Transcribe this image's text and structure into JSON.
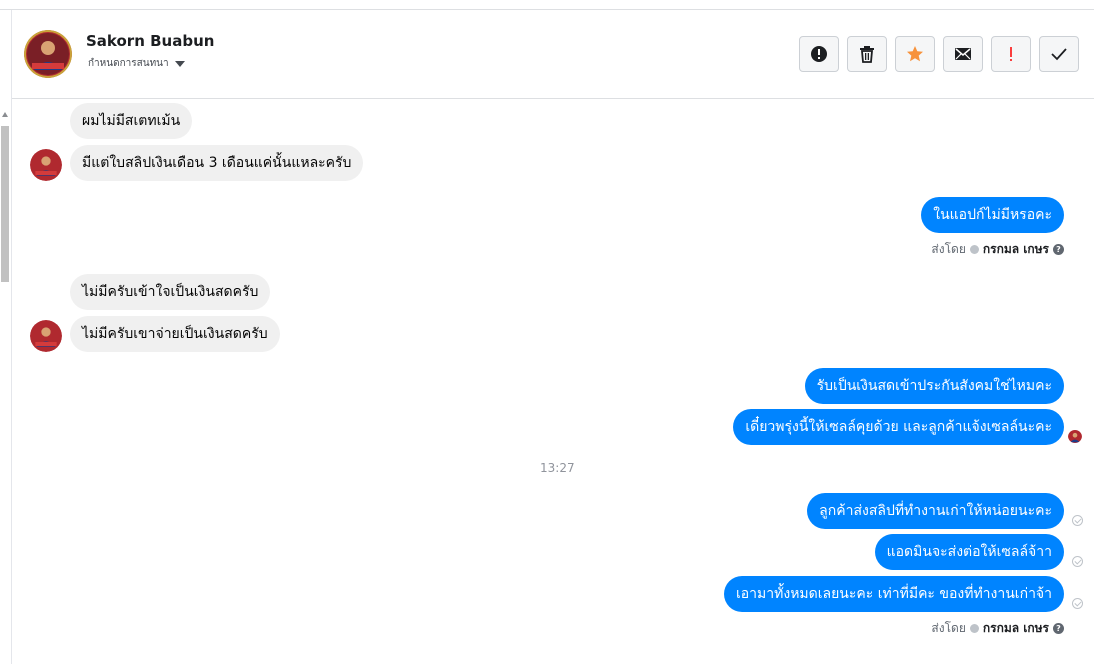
{
  "header": {
    "contact_name": "Sakorn Buabun",
    "conversation_setting": "กำหนดการสนทนา",
    "actions": [
      {
        "name": "mark-spam-button",
        "icon": "exclamation-circle-icon"
      },
      {
        "name": "delete-button",
        "icon": "trash-icon"
      },
      {
        "name": "star-button",
        "icon": "star-icon",
        "color": "#f7923b"
      },
      {
        "name": "mark-unread-button",
        "icon": "envelope-icon"
      },
      {
        "name": "follow-up-button",
        "icon": "exclamation-icon",
        "color": "#fa3e3e"
      },
      {
        "name": "mark-done-button",
        "icon": "check-icon"
      }
    ]
  },
  "messages": {
    "in_1": "ผมไม่มีสเตทเม้น",
    "in_2": "มีแต่ใบสลิปเงินเดือน 3 เดือนแค่นั้นแหละครับ",
    "out_1": "ในแอปก์ไม่มีหรอคะ",
    "in_3": "ไม่มีครับเข้าใจเป็นเงินสดครับ",
    "in_4": "ไม่มีครับเขาจ่ายเป็นเงินสดครับ",
    "out_2": "รับเป็นเงินสดเข้าประกันสังคมใช่ไหมคะ",
    "out_3": "เดี๋ยวพรุ่งนี้ให้เซลล์คุยด้วย และลูกค้าแจ้งเซลล์นะคะ",
    "time_separator": "13:27",
    "out_4": "ลูกค้าส่งสลิปที่ทำงานเก่าให้หน่อยนะคะ",
    "out_5": "แอดมินจะส่งต่อให้เซลล์จ้าา",
    "out_6": "เอามาทั้งหมดเลยนะคะ เท่าที่มีคะ ของที่ทำงานเก่าจ้า"
  },
  "sent_by": {
    "label": "ส่งโดย",
    "agent": "กรกมล เกษร"
  },
  "colors": {
    "outgoing_bubble": "#0084ff",
    "incoming_bubble": "#f0f0f0"
  }
}
